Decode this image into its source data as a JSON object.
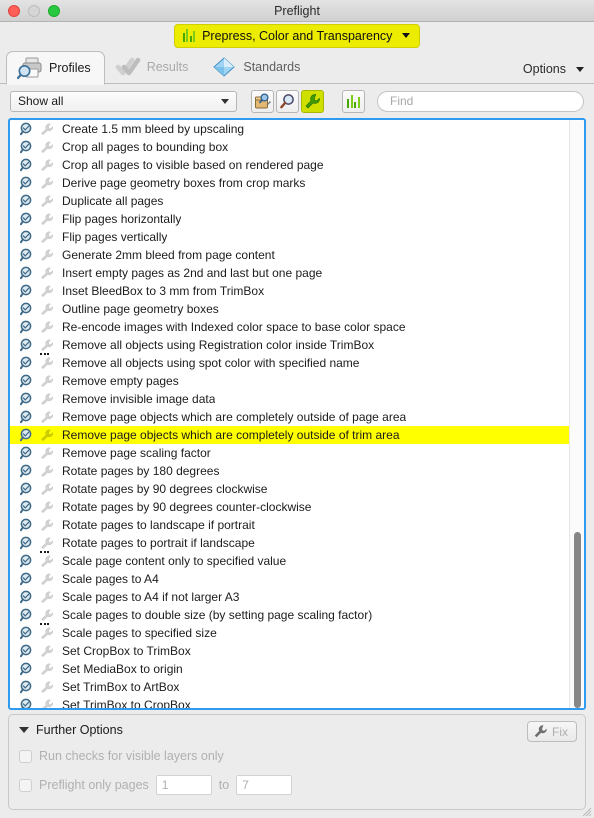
{
  "window": {
    "title": "Preflight",
    "traffic_lights": [
      "close-button",
      "minimize-button",
      "zoom-button"
    ]
  },
  "profile_selector": {
    "label": "Prepress, Color and Transparency",
    "icon": "bar-chart-icon",
    "background": "#ecec00"
  },
  "tabs": [
    {
      "label": "Profiles",
      "icon": "printer-magnifier-icon",
      "state": "active"
    },
    {
      "label": "Results",
      "icon": "double-check-icon",
      "state": "disabled"
    },
    {
      "label": "Standards",
      "icon": "diamond-icon",
      "state": "normal"
    }
  ],
  "options_menu": {
    "label": "Options",
    "icon": "chevron-down-icon"
  },
  "toolbar": {
    "filter_select": {
      "value": "Show all",
      "icon": "chevron-down-icon"
    },
    "buttons": [
      {
        "name": "new-profile-button",
        "icon": "profile-new-icon",
        "selected": false
      },
      {
        "name": "inspect-button",
        "icon": "magnifier-icon",
        "selected": false
      },
      {
        "name": "fixup-button",
        "icon": "wrench-icon",
        "selected": true
      }
    ],
    "bars_button": {
      "name": "profiles-view-button",
      "icon": "bar-chart-icon"
    },
    "find": {
      "placeholder": "Find",
      "value": ""
    }
  },
  "list": {
    "selected_index": 17,
    "scrollbar": {
      "thumb_top_pct": 70,
      "thumb_height_pct": 30
    },
    "items": [
      {
        "label": "Create 1.5 mm bleed by upscaling",
        "has_params": false
      },
      {
        "label": "Crop all pages to bounding box",
        "has_params": false
      },
      {
        "label": "Crop all pages to visible based on rendered page",
        "has_params": false
      },
      {
        "label": "Derive page geometry boxes from crop marks",
        "has_params": false
      },
      {
        "label": "Duplicate all pages",
        "has_params": false
      },
      {
        "label": "Flip pages horizontally",
        "has_params": false
      },
      {
        "label": "Flip pages vertically",
        "has_params": false
      },
      {
        "label": "Generate 2mm bleed from page content",
        "has_params": false
      },
      {
        "label": "Insert empty pages as 2nd and last but one page",
        "has_params": false
      },
      {
        "label": "Inset BleedBox to 3 mm from TrimBox",
        "has_params": false
      },
      {
        "label": "Outline page geometry boxes",
        "has_params": false
      },
      {
        "label": "Re-encode images with Indexed color space to base color space",
        "has_params": false
      },
      {
        "label": "Remove all objects using Registration color inside TrimBox",
        "has_params": false
      },
      {
        "label": "Remove all objects using spot color with specified name",
        "has_params": true
      },
      {
        "label": "Remove empty pages",
        "has_params": false
      },
      {
        "label": "Remove invisible image data",
        "has_params": false
      },
      {
        "label": "Remove page objects which are completely outside of page area",
        "has_params": false
      },
      {
        "label": "Remove page objects which are completely outside of trim area",
        "has_params": false
      },
      {
        "label": "Remove page scaling factor",
        "has_params": false
      },
      {
        "label": "Rotate pages by 180 degrees",
        "has_params": false
      },
      {
        "label": "Rotate pages by 90 degrees clockwise",
        "has_params": false
      },
      {
        "label": "Rotate pages by 90 degrees counter-clockwise",
        "has_params": false
      },
      {
        "label": "Rotate pages to landscape if portrait",
        "has_params": false
      },
      {
        "label": "Rotate pages to portrait if landscape",
        "has_params": false
      },
      {
        "label": "Scale page content only to specified value",
        "has_params": true
      },
      {
        "label": "Scale pages to A4",
        "has_params": false
      },
      {
        "label": "Scale pages to A4 if not larger A3",
        "has_params": false
      },
      {
        "label": "Scale pages to double size (by setting page scaling factor)",
        "has_params": false
      },
      {
        "label": "Scale pages to specified size",
        "has_params": true
      },
      {
        "label": "Set CropBox to TrimBox",
        "has_params": false
      },
      {
        "label": "Set MediaBox to origin",
        "has_params": false
      },
      {
        "label": "Set TrimBox to ArtBox",
        "has_params": false
      },
      {
        "label": "Set TrimBox to CropBox",
        "has_params": false
      }
    ]
  },
  "further_options": {
    "title": "Further Options",
    "expanded": true,
    "fix_button": {
      "label": "Fix",
      "icon": "wrench-icon",
      "enabled": false
    },
    "visible_layers": {
      "label": "Run checks for visible layers only",
      "checked": false
    },
    "page_range": {
      "label": "Preflight only pages",
      "checked": false,
      "from": "1",
      "to_label": "to",
      "to": "7"
    }
  },
  "colors": {
    "highlight_yellow": "#ffff00",
    "focus_blue": "#2e9bf0",
    "profile_yellow": "#ecec00",
    "accent_green": "#7ccc1a"
  }
}
